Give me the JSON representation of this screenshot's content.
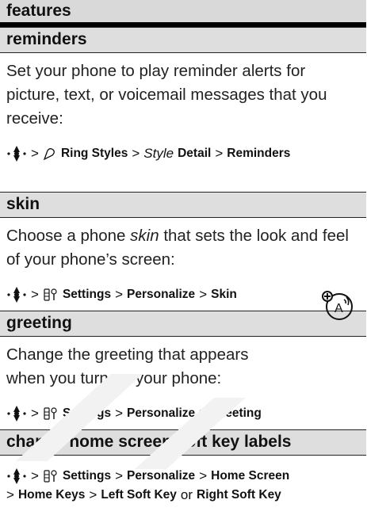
{
  "header": {
    "title": "features"
  },
  "sections": [
    {
      "title": "reminders",
      "body": "Set your phone to play reminder alerts for picture, text, or voicemail messages that you receive:",
      "path": [
        "Ring Styles",
        "Style",
        "Detail",
        "Reminders"
      ]
    },
    {
      "title": "skin",
      "body_pre": "Choose a phone ",
      "body_em": "skin",
      "body_post": " that sets the look and feel of your phone’s screen:",
      "path": [
        "Settings",
        "Personalize",
        "Skin"
      ]
    },
    {
      "title": "greeting",
      "body": "Change the greeting that appears when you turn on your phone:",
      "path": [
        "Settings",
        "Personalize",
        "Greeting"
      ]
    },
    {
      "title": "change home screen soft key labels",
      "path": [
        "Settings",
        "Personalize",
        "Home Screen",
        "Home Keys",
        "Left Soft Key",
        "or",
        "Right Soft Key"
      ]
    }
  ],
  "separator": ">",
  "icons": {
    "nav": "nav-key-icon",
    "ring": "ring-styles-icon",
    "settings": "settings-icon",
    "feature": "network-feature-icon"
  }
}
